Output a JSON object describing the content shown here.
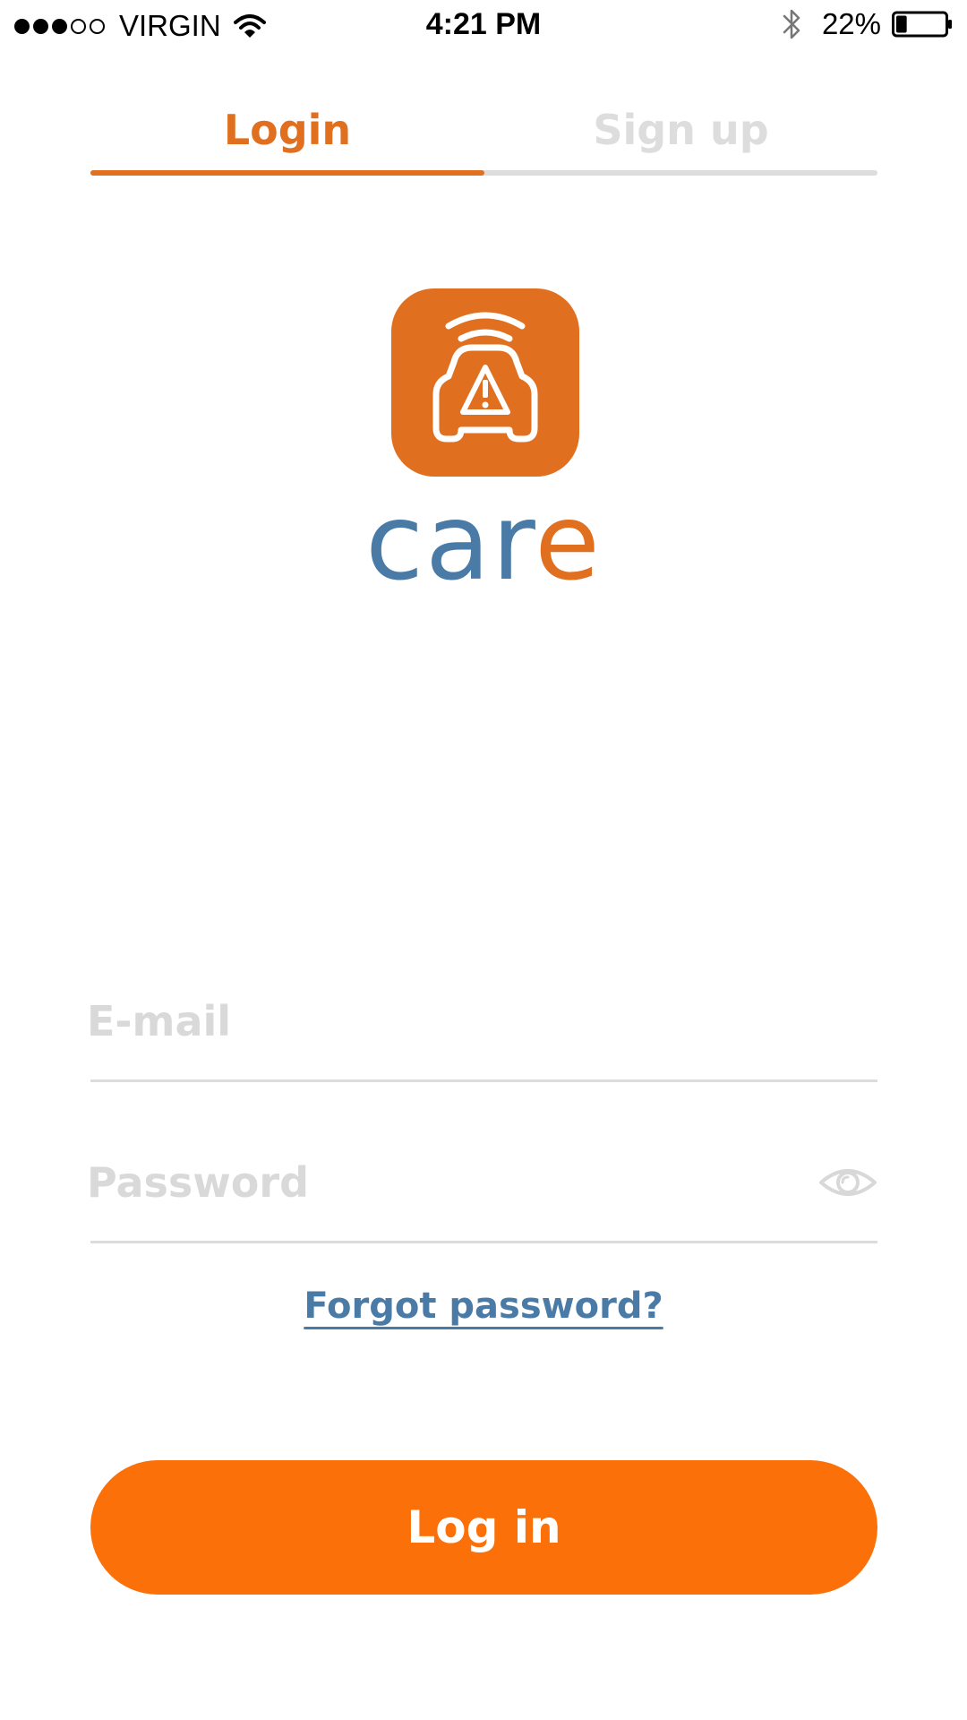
{
  "status_bar": {
    "signal_filled": 3,
    "signal_total": 5,
    "carrier": "VIRGIN",
    "time": "4:21 PM",
    "battery_percent_text": "22%",
    "battery_level": 0.22,
    "icons": [
      "wifi-icon",
      "bluetooth-icon",
      "battery-icon"
    ]
  },
  "tabs": {
    "login_label": "Login",
    "signup_label": "Sign up",
    "active": "login"
  },
  "logo": {
    "icon": "car-warning-icon",
    "wordmark_part1": "car",
    "wordmark_part2": "e"
  },
  "form": {
    "email_placeholder": "E-mail",
    "email_value": "",
    "password_placeholder": "Password",
    "password_value": "",
    "show_password_icon": "eye-icon",
    "forgot_label": "Forgot password?",
    "submit_label": "Log in"
  },
  "colors": {
    "accent": "#e07020",
    "button": "#fb7008",
    "brand_blue": "#4a7aa6",
    "inactive_text": "#dddddd",
    "placeholder": "#d9d9d9",
    "divider": "#dcdcdc"
  }
}
